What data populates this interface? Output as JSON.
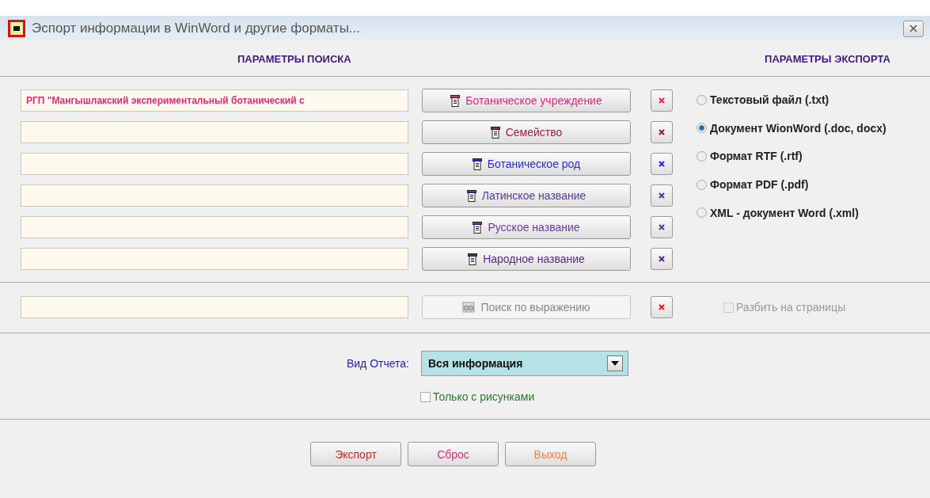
{
  "window": {
    "title": "Эспорт информации в WinWord и другие форматы..."
  },
  "search_header": "ПАРАМЕТРЫ ПОИСКА",
  "export_header": "ПАРАМЕТРЫ ЭКСПОРТА",
  "filters": [
    {
      "value": "РГП \"Мангышлакский экспериментальный ботанический с",
      "button": "Ботаническое учреждение",
      "color": "#e0287a"
    },
    {
      "button": "Семейство",
      "color": "#a02040"
    },
    {
      "button": "Ботаническое род",
      "color": "#2a2ae0"
    },
    {
      "button": "Латинское название",
      "color": "#5a3a9a"
    },
    {
      "button": "Русское название",
      "color": "#6a3aa0"
    },
    {
      "button": "Народное название",
      "color": "#5a2a8a"
    }
  ],
  "formats": [
    {
      "label": "Текстовый файл (.txt)",
      "selected": false
    },
    {
      "label": "Документ WionWord (.doc, docx)",
      "selected": true
    },
    {
      "label": "Формат RTF (.rtf)",
      "selected": false
    },
    {
      "label": "Формат PDF (.pdf)",
      "selected": false
    },
    {
      "label": "XML - документ Word (.xml)",
      "selected": false
    }
  ],
  "expression": {
    "button": "Поиск по выражению",
    "disabled": true
  },
  "split_pages": {
    "label": "Разбить на страницы",
    "checked": false,
    "disabled": true
  },
  "report_type": {
    "label": "Вид Отчета:",
    "value": "Вся информация"
  },
  "only_pictures": {
    "label": "Только с рисунками",
    "checked": false
  },
  "actions": [
    {
      "label": "Экспорт",
      "color": "#e02020"
    },
    {
      "label": "Сброс",
      "color": "#e0287a"
    },
    {
      "label": "Выход",
      "color": "#f08040"
    }
  ]
}
